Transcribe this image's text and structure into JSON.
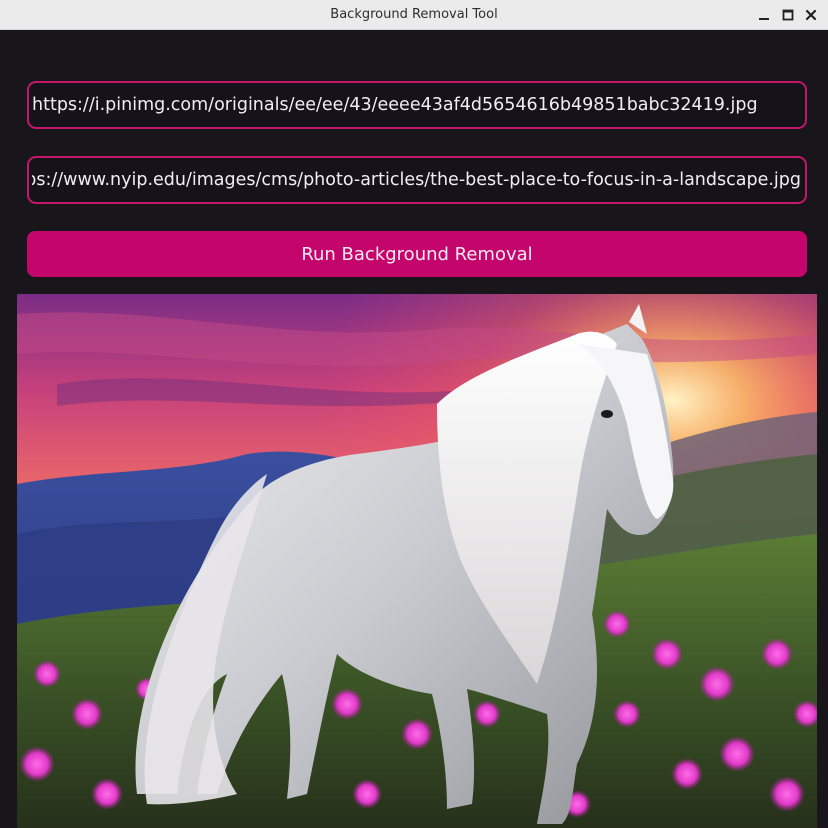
{
  "window": {
    "title": "Background Removal Tool"
  },
  "inputs": {
    "foreground_url": "https://i.pinimg.com/originals/ee/ee/43/eeee43af4d5654616b49851babc32419.jpg",
    "background_url": "https://www.nyip.edu/images/cms/photo-articles/the-best-place-to-focus-in-a-landscape.jpg"
  },
  "actions": {
    "run_label": "Run Background Removal"
  },
  "result": {
    "description_icon": "composited-image"
  },
  "colors": {
    "accent": "#c4066c",
    "field_border": "#c2176b",
    "window_bg": "#18151b"
  }
}
